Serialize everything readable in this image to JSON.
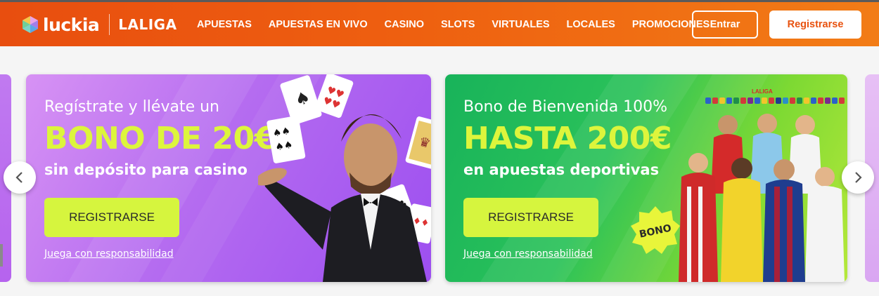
{
  "header": {
    "logo_text": "luckia",
    "partner_text": "LALIGA",
    "nav": [
      "APUESTAS",
      "APUESTAS EN VIVO",
      "CASINO",
      "SLOTS",
      "VIRTUALES",
      "LOCALES",
      "PROMOCIONES"
    ],
    "login_label": "Entrar",
    "register_label": "Registrarse"
  },
  "colors": {
    "header_orange": "#e84e0f",
    "accent_lime": "#d6f53e",
    "casino_purple": "#b56cf0",
    "sports_green": "#2bc25a"
  },
  "banners": [
    {
      "line1": "Regístrate y llévate un",
      "line2": "BONO DE 20€",
      "line3": "sin depósito para casino",
      "cta": "REGISTRARSE",
      "link": "Juega con responsabilidad"
    },
    {
      "line1": "Bono de Bienvenida 100%",
      "line2": "HASTA 200€",
      "line3": "en apuestas deportivas",
      "cta": "REGISTRARSE",
      "link": "Juega con responsabilidad",
      "badge": "BONO",
      "league": "LALIGA"
    }
  ],
  "carousel": {
    "prev_icon": "chevron-left-icon",
    "next_icon": "chevron-right-icon"
  }
}
